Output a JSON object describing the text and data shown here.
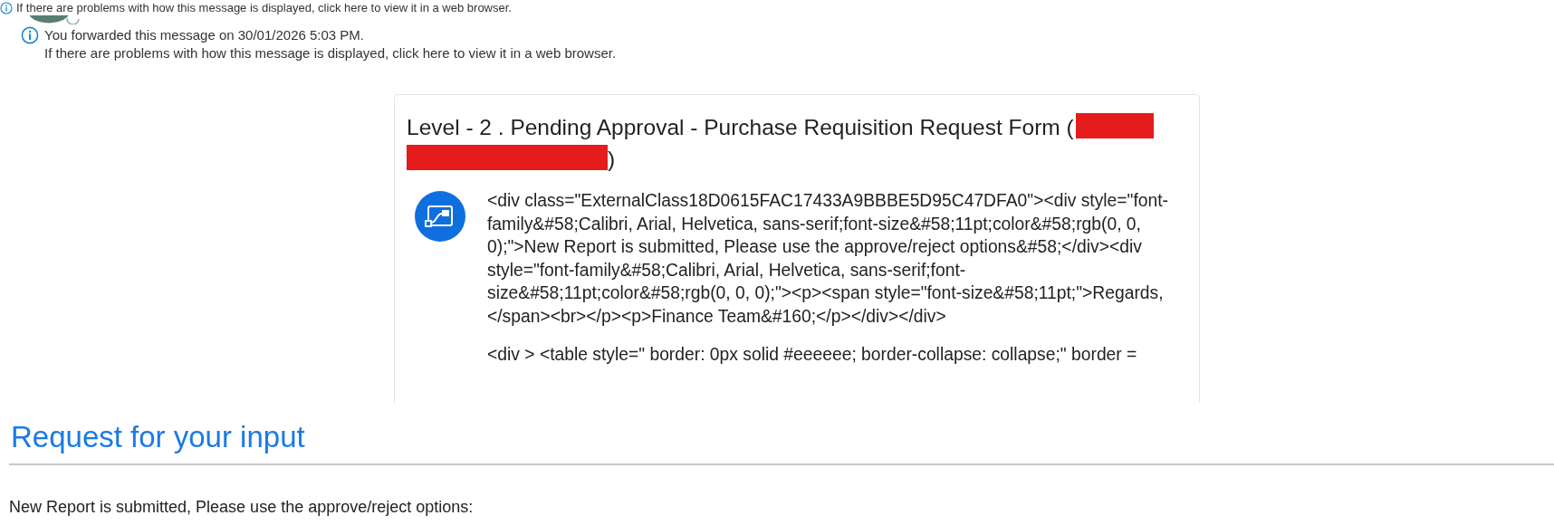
{
  "notice": {
    "cut_line": "If there are problems with how this message is displayed, click here to view it in a web browser.",
    "forwarded": "You forwarded this message on 30/01/2026 5:03 PM.",
    "browser_hint": "If there are problems with how this message is displayed, click here to view it in a web browser."
  },
  "card": {
    "title": "Level - 2 . Pending Approval - Purchase Requisition Request Form (",
    "title_end": ")",
    "paragraphs": [
      "<div class=\"ExternalClass18D0615FAC17433A9BBBE5D95C47DFA0\"><div style=\"font-family&#58;Calibri, Arial, Helvetica, sans-serif;font-size&#58;11pt;color&#58;rgb(0, 0, 0);\">New Report is submitted, Please use the approve/reject options&#58;</div><div style=\"font-family&#58;Calibri, Arial, Helvetica, sans-serif;font-size&#58;11pt;color&#58;rgb(0, 0, 0);\"><p><span style=\"font-size&#58;11pt;\">Regards,</span><br></p><p>Finance Team&#160;</p></div></div>",
      "<div > <table style=\" border: 0px solid #eeeeee; border-collapse: collapse;\" border ="
    ]
  },
  "request": {
    "heading": "Request for your input",
    "text": "New Report is submitted, Please use the approve/reject options:"
  }
}
